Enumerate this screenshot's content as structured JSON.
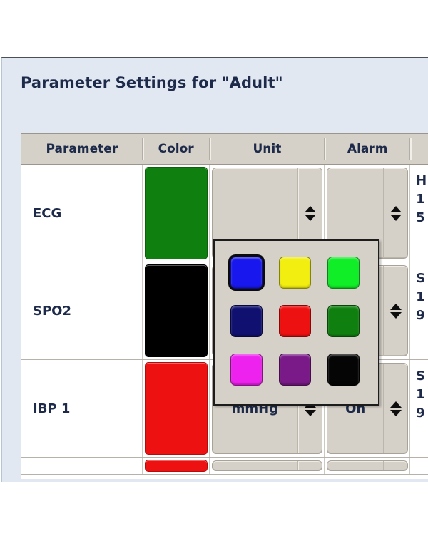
{
  "dialog": {
    "title": "Parameter Settings for \"Adult\""
  },
  "table": {
    "columns": [
      {
        "key": "parameter",
        "label": "Parameter"
      },
      {
        "key": "color",
        "label": "Color"
      },
      {
        "key": "unit",
        "label": "Unit"
      },
      {
        "key": "alarm",
        "label": "Alarm"
      },
      {
        "key": "limits",
        "label": ""
      }
    ],
    "rows": [
      {
        "parameter": "ECG",
        "color": "#0f800f",
        "color_name": "green",
        "unit": "",
        "alarm": "",
        "limits": "H\n1\n5"
      },
      {
        "parameter": "SPO2",
        "color": "#000000",
        "color_name": "black",
        "unit": "",
        "alarm": "",
        "limits": "S\n1\n9"
      },
      {
        "parameter": "IBP 1",
        "color": "#ee1111",
        "color_name": "red",
        "unit": "mmHg",
        "alarm": "On",
        "limits": "S\n1\n9"
      },
      {
        "parameter": "",
        "color": "#ee1111",
        "color_name": "red",
        "unit": "",
        "alarm": "",
        "limits": ""
      }
    ]
  },
  "color_popup": {
    "visible": true,
    "selected_index": 0,
    "swatches": [
      {
        "name": "blue",
        "hex": "#1818ee",
        "selected": true
      },
      {
        "name": "yellow",
        "hex": "#f2ee10",
        "selected": false
      },
      {
        "name": "bright-green",
        "hex": "#10ee28",
        "selected": false
      },
      {
        "name": "navy",
        "hex": "#101070",
        "selected": false
      },
      {
        "name": "red",
        "hex": "#ee1111",
        "selected": false
      },
      {
        "name": "dark-green",
        "hex": "#0f800f",
        "selected": false
      },
      {
        "name": "magenta",
        "hex": "#ee22ee",
        "selected": false
      },
      {
        "name": "purple",
        "hex": "#7a1a88",
        "selected": false
      },
      {
        "name": "black",
        "hex": "#050505",
        "selected": false
      }
    ]
  },
  "theme": {
    "dialog_background": "#e1e8f2",
    "header_background": "#d6d1c8",
    "control_background": "#d6d1c8",
    "text_color": "#1d2a4a",
    "popup_border": "#1c1c1c"
  }
}
